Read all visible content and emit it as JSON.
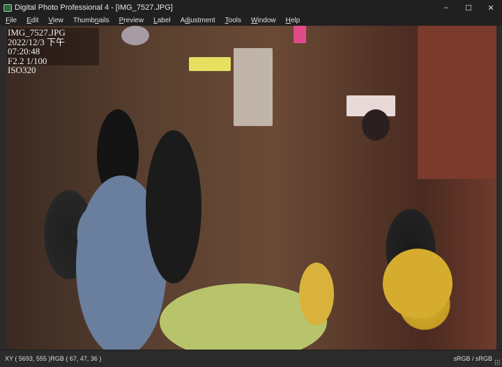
{
  "window": {
    "title": "Digital Photo Professional 4 - [IMG_7527.JPG]",
    "minimize": "–",
    "maximize": "☐",
    "close": "✕"
  },
  "menu": [
    {
      "pre": "",
      "ul": "F",
      "post": "ile"
    },
    {
      "pre": "",
      "ul": "E",
      "post": "dit"
    },
    {
      "pre": "",
      "ul": "V",
      "post": "iew"
    },
    {
      "pre": "Thumb",
      "ul": "n",
      "post": "ails"
    },
    {
      "pre": "",
      "ul": "P",
      "post": "review"
    },
    {
      "pre": "",
      "ul": "L",
      "post": "abel"
    },
    {
      "pre": "A",
      "ul": "d",
      "post": "justment"
    },
    {
      "pre": "",
      "ul": "T",
      "post": "ools"
    },
    {
      "pre": "",
      "ul": "W",
      "post": "indow"
    },
    {
      "pre": "",
      "ul": "H",
      "post": "elp"
    }
  ],
  "info": {
    "filename": "IMG_7527.JPG",
    "datetime": "2022/12/3 下午 07:20:48",
    "exposure": "F2.2 1/100",
    "iso": "ISO320"
  },
  "status": {
    "coords": "XY ( 5693,  555 )RGB (  67,  47,  36 )",
    "colorspace": "sRGB / sRGB"
  }
}
